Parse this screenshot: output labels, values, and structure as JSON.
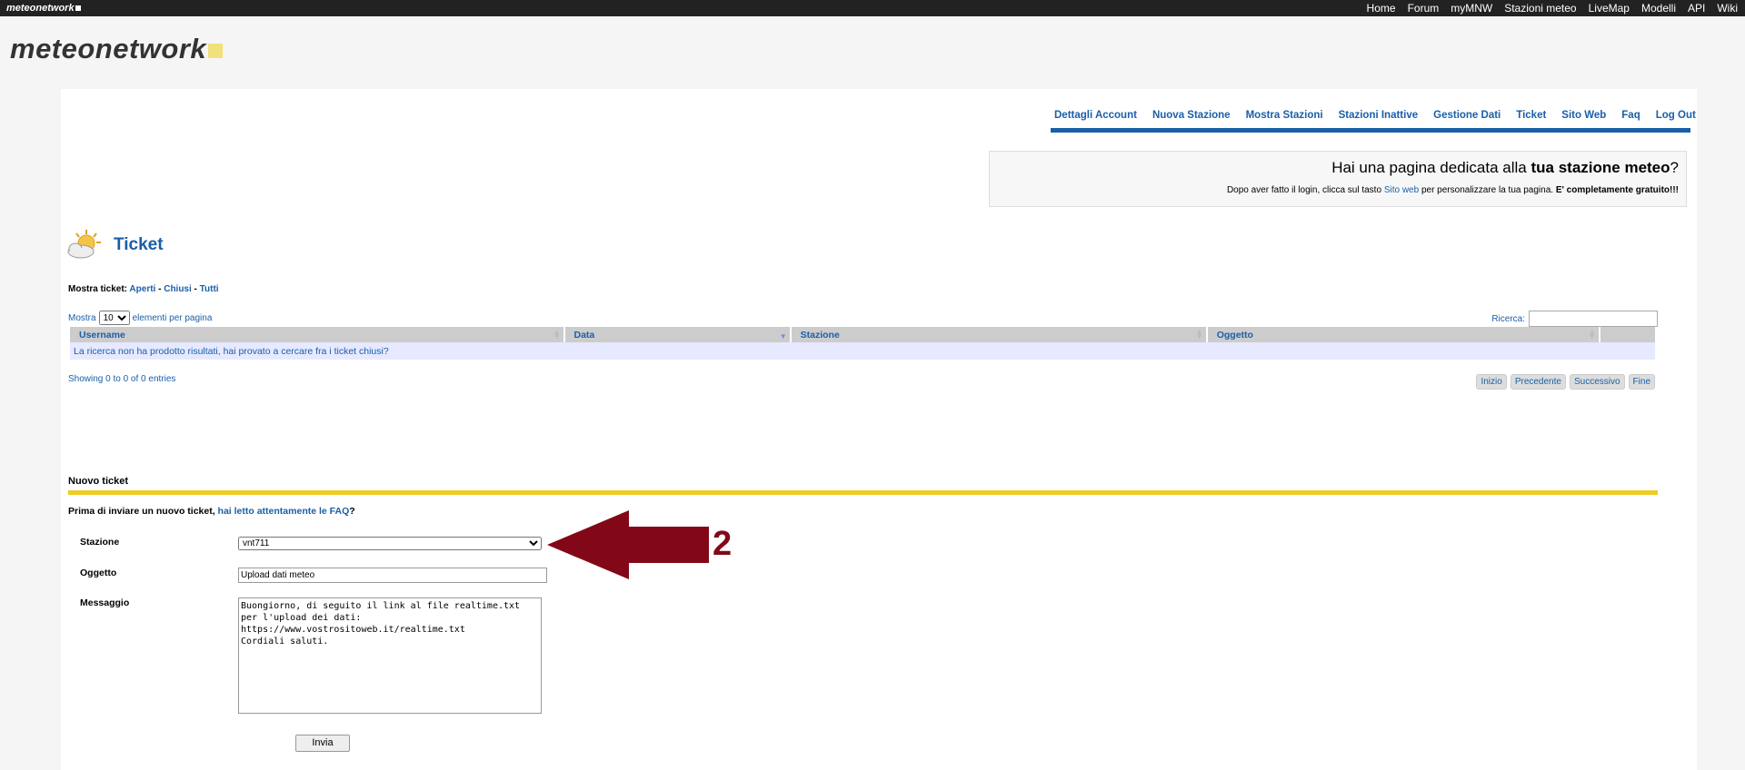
{
  "topbar": {
    "brand": "meteonetwork",
    "nav": [
      "Home",
      "Forum",
      "myMNW",
      "Stazioni meteo",
      "LiveMap",
      "Modelli",
      "API",
      "Wiki"
    ]
  },
  "logo": "meteonetwork",
  "subnav": [
    "Dettagli Account",
    "Nuova Stazione",
    "Mostra Stazioni",
    "Stazioni Inattive",
    "Gestione Dati",
    "Ticket",
    "Sito Web",
    "Faq",
    "Log Out"
  ],
  "promo": {
    "line1_pre": "Hai una pagina dedicata alla ",
    "line1_bold": "tua stazione meteo",
    "line1_post": "?",
    "line2_pre": "Dopo aver fatto il login, clicca sul tasto ",
    "line2_link": "Sito web",
    "line2_mid": " per personalizzare la tua pagina. ",
    "line2_bold": "E' completamente gratuito!!!"
  },
  "ticket": {
    "title": "Ticket",
    "filter_label": "Mostra ticket: ",
    "filter_open": "Aperti",
    "filter_closed": "Chiusi",
    "filter_all": "Tutti",
    "sep": " - ",
    "length_pre": "Mostra",
    "length_value": "10",
    "length_post": "elementi per pagina",
    "search_label": "Ricerca:",
    "columns": [
      "Username",
      "Data",
      "Stazione",
      "Oggetto"
    ],
    "empty": "La ricerca non ha prodotto risultati, hai provato a cercare fra i ticket chiusi?",
    "showing": "Showing 0 to 0 of 0 entries",
    "pager": [
      "Inizio",
      "Precedente",
      "Successivo",
      "Fine"
    ]
  },
  "nuovo": {
    "title": "Nuovo ticket",
    "prima_pre": "Prima di inviare un nuovo ticket, ",
    "prima_link": "hai letto attentamente le FAQ",
    "prima_post": "?",
    "stazione_label": "Stazione",
    "stazione_value": "vnt711",
    "oggetto_label": "Oggetto",
    "oggetto_value": "Upload dati meteo",
    "messaggio_label": "Messaggio",
    "messaggio_value": "Buongiorno, di seguito il link al file realtime.txt\nper l'upload dei dati:\nhttps://www.vostrositoweb.it/realtime.txt\nCordiali saluti.",
    "submit": "Invia"
  },
  "annotation": {
    "step": "2",
    "color": "#820817"
  }
}
